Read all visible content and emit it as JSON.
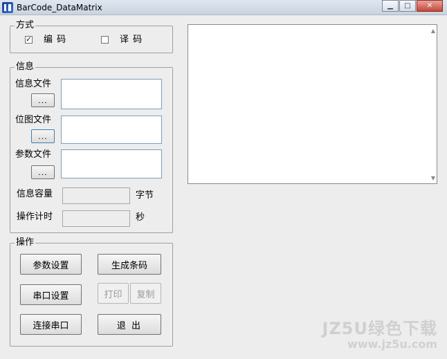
{
  "window": {
    "title": "BarCode_DataMatrix",
    "minimize": "▁",
    "maximize": "□",
    "close": "✕"
  },
  "mode": {
    "title": "方式",
    "encode": {
      "label": "编  码",
      "checked": "✓"
    },
    "decode": {
      "label": "译  码",
      "checked": ""
    }
  },
  "info": {
    "title": "信息",
    "info_file_label": "信息文件",
    "bitmap_file_label": "位图文件",
    "param_file_label": "参数文件",
    "browse_label": "...",
    "capacity_label": "信息容量",
    "capacity_unit": "字节",
    "timer_label": "操作计时",
    "timer_unit": "秒"
  },
  "operation": {
    "title": "操作",
    "param_settings": "参数设置",
    "generate_barcode": "生成条码",
    "serial_settings": "串口设置",
    "print": "打印",
    "copy": "复制",
    "connect_serial": "连接串口",
    "exit": "退  出"
  },
  "watermark": {
    "line1": "JZ5U绿色下载",
    "line2": "www.jz5u.com"
  }
}
